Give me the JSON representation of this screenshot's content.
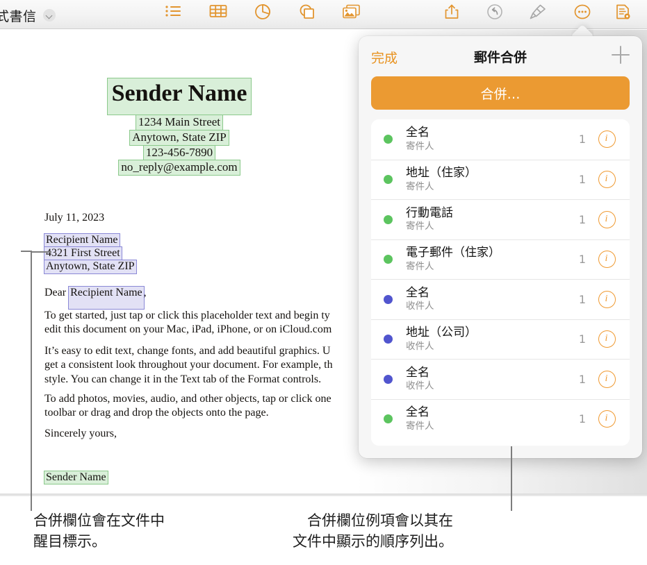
{
  "toolbar": {
    "document_title": "式書信",
    "title_chevron_icon": "chevron-down-icon",
    "buttons": [
      {
        "name": "list-icon",
        "label": "列表"
      },
      {
        "name": "table-icon",
        "label": "表格"
      },
      {
        "name": "chart-icon",
        "label": "圖表"
      },
      {
        "name": "shape-icon",
        "label": "形狀"
      },
      {
        "name": "media-icon",
        "label": "媒體"
      },
      {
        "name": "share-icon",
        "label": "分享"
      },
      {
        "name": "undo-icon",
        "label": "還原"
      },
      {
        "name": "format-brush-icon",
        "label": "格式"
      },
      {
        "name": "more-icon",
        "label": "更多"
      },
      {
        "name": "document-icon",
        "label": "文件"
      }
    ]
  },
  "document": {
    "sender_name": "Sender Name",
    "sender_address_lines": [
      "1234 Main Street",
      "Anytown, State ZIP",
      "123-456-7890",
      "no_reply@example.com"
    ],
    "date": "July 11, 2023",
    "recipient_lines": [
      "Recipient Name",
      "4321 First Street",
      "Anytown, State ZIP"
    ],
    "salutation_prefix": "Dear ",
    "salutation_field": "Recipient Name",
    "salutation_suffix": ",",
    "paragraph_1": "To get started, just tap or click this placeholder text and begin ty\nedit this document on your Mac, iPad, iPhone, or on iCloud.com",
    "paragraph_2": "It’s easy to edit text, change fonts, and add beautiful graphics. U\nget a consistent look throughout your document. For example, th\nstyle. You can change it in the Text tab of the Format controls.",
    "paragraph_3": "To add photos, movies, audio, and other objects, tap or click one\ntoolbar or drag and drop the objects onto the page.",
    "closing": "Sincerely yours,",
    "signature": "Sender Name"
  },
  "popover": {
    "done_label": "完成",
    "title": "郵件合併",
    "add_icon": "plus-icon",
    "merge_button_label": "合併…",
    "colors": {
      "sender_dot": "#5cc45f",
      "recipient_dot": "#5155ce",
      "accent": "#eb9a32"
    },
    "fields": [
      {
        "title": "全名",
        "subtitle": "寄件人",
        "count": "1",
        "dot": "sender",
        "info_icon": "info-icon"
      },
      {
        "title": "地址（住家）",
        "subtitle": "寄件人",
        "count": "1",
        "dot": "sender",
        "info_icon": "info-icon"
      },
      {
        "title": "行動電話",
        "subtitle": "寄件人",
        "count": "1",
        "dot": "sender",
        "info_icon": "info-icon"
      },
      {
        "title": "電子郵件（住家）",
        "subtitle": "寄件人",
        "count": "1",
        "dot": "sender",
        "info_icon": "info-icon"
      },
      {
        "title": "全名",
        "subtitle": "收件人",
        "count": "1",
        "dot": "recipient",
        "info_icon": "info-icon"
      },
      {
        "title": "地址（公司）",
        "subtitle": "收件人",
        "count": "1",
        "dot": "recipient",
        "info_icon": "info-icon"
      },
      {
        "title": "全名",
        "subtitle": "收件人",
        "count": "1",
        "dot": "recipient",
        "info_icon": "info-icon"
      },
      {
        "title": "全名",
        "subtitle": "寄件人",
        "count": "1",
        "dot": "sender",
        "info_icon": "info-icon"
      }
    ]
  },
  "callouts": {
    "left": "合併欄位會在文件中\n醒目標示。",
    "right": "　合併欄位例項會以其在\n文件中顯示的順序列出。"
  }
}
